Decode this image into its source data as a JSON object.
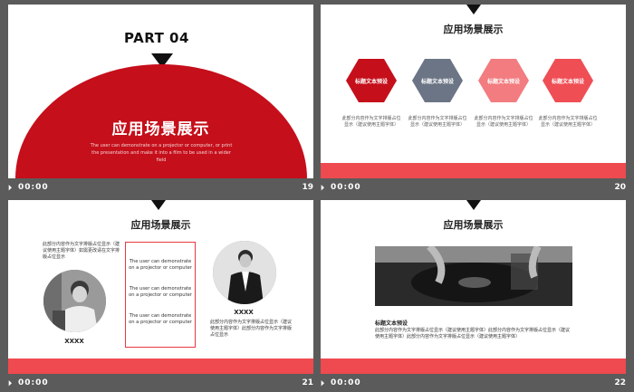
{
  "slides": [
    {
      "number": "19",
      "time": "00:00",
      "part_label": "PART 04",
      "title": "应用场景展示",
      "description": "The user can demonstrate on a projector or computer, or print the presentation and make it into a film to be used in a wider field"
    },
    {
      "number": "20",
      "time": "00:00",
      "title": "应用场景展示",
      "items": [
        {
          "label": "标题文本预设",
          "caption": "此部分内容作为文字排版占位显示（建议使用主题字体）",
          "color": "#c50f1b"
        },
        {
          "label": "标题文本预设",
          "caption": "此部分内容作为文字排版占位显示（建议使用主题字体）",
          "color": "#6b7585"
        },
        {
          "label": "标题文本预设",
          "caption": "此部分内容作为文字排版占位显示（建议使用主题字体）",
          "color": "#f27c80"
        },
        {
          "label": "标题文本预设",
          "caption": "此部分内容作为文字排版占位显示（建议使用主题字体）",
          "color": "#ef4e55"
        }
      ]
    },
    {
      "number": "21",
      "time": "00:00",
      "title": "应用场景展示",
      "left_text": "此部分内容作为文字排版占位显示（建议使用主题字体）如需更改请在文字排版占位显示",
      "left_name": "XXXX",
      "right_text": "此部分内容作为文字排版占位显示（建议使用主题字体）此部分内容作为文字排版占位显示",
      "right_name": "XXXX",
      "box_lines": [
        "The user can demonstrate on a projector or computer",
        "The user can demonstrate on a projector or computer",
        "The user can demonstrate on a projector or computer"
      ]
    },
    {
      "number": "22",
      "time": "00:00",
      "title": "应用场景展示",
      "subtitle": "标题文本预设",
      "body": "此部分内容作为文字排版占位显示（建议使用主题字体）此部分内容作为文字排版占位显示（建议使用主题字体）此部分内容作为文字排版占位显示（建议使用主题字体）"
    }
  ],
  "colors": {
    "accent_red": "#c50f1b",
    "band_red": "#ee4a4f",
    "background": "#5b5b5b"
  }
}
